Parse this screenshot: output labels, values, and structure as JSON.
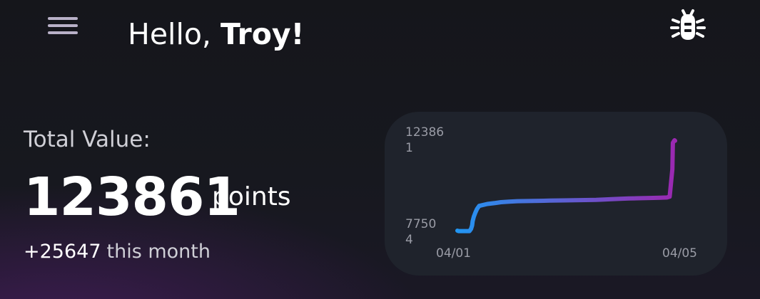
{
  "header": {
    "greeting_prefix": "Hello,",
    "user_name": "Troy!",
    "menu_icon": "hamburger-menu-icon",
    "bug_icon": "bug-icon"
  },
  "summary": {
    "label": "Total Value:",
    "value": "123861",
    "unit": "points",
    "delta": "+25647",
    "delta_period": "this month"
  },
  "colors": {
    "line_start": "#2196f3",
    "line_end": "#9c27b0",
    "card_bg": "#1f232c"
  },
  "chart_data": {
    "type": "line",
    "title": "",
    "xlabel": "",
    "ylabel": "",
    "y_tick_labels": [
      "12386\n1",
      "7750\n4"
    ],
    "x_tick_labels": [
      "04/01",
      "04/05"
    ],
    "ylim": [
      77504,
      123861
    ],
    "xlim": [
      0,
      4
    ],
    "grid": false,
    "legend": "none",
    "series": [
      {
        "x": [
          0,
          0.02,
          0.2,
          0.22,
          0.23,
          0.25,
          0.27,
          0.28,
          0.3,
          0.33,
          0.36,
          0.4,
          0.55,
          0.7,
          0.8,
          0.95,
          1.1,
          1.3,
          1.5,
          1.7,
          1.95,
          2.15,
          2.35,
          2.55,
          2.7,
          2.8,
          2.95,
          3.15,
          3.3,
          3.45,
          3.6,
          3.72,
          3.85,
          3.9,
          3.95,
          3.96,
          3.99,
          4.0
        ],
        "y": [
          77504,
          77300,
          77300,
          77300,
          77600,
          78400,
          80200,
          82300,
          84600,
          86800,
          88600,
          90200,
          91200,
          91700,
          92100,
          92400,
          92600,
          92700,
          92800,
          92900,
          93000,
          93100,
          93200,
          93300,
          93500,
          93600,
          93800,
          94000,
          94100,
          94200,
          94300,
          94400,
          94500,
          94900,
          109000,
          122500,
          123861,
          123600
        ]
      }
    ]
  }
}
